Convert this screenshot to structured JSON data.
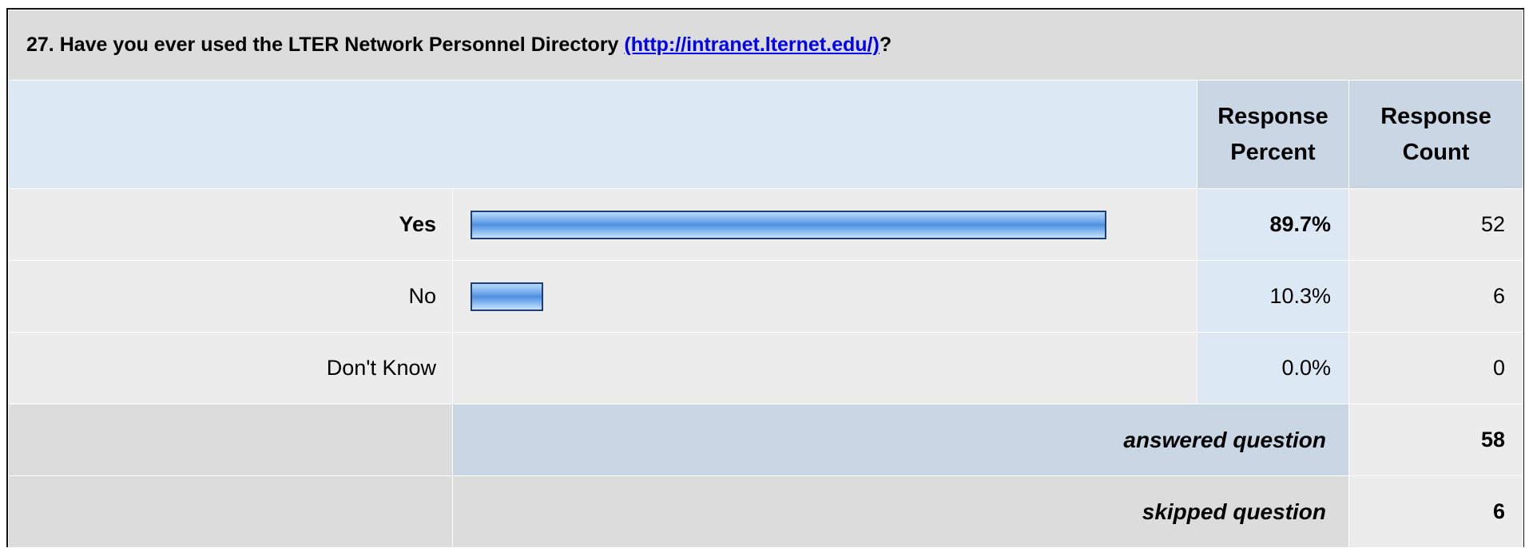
{
  "question": {
    "prefix": "27. Have you ever used the LTER Network Personnel Directory ",
    "link_text": "(http://intranet.lternet.edu/)",
    "suffix": "?"
  },
  "columns": {
    "percent": [
      "Response",
      "Percent"
    ],
    "count": [
      "Response",
      "Count"
    ]
  },
  "rows": [
    {
      "label": "Yes",
      "percent_text": "89.7%",
      "count_text": "52",
      "bold": true
    },
    {
      "label": "No",
      "percent_text": "10.3%",
      "count_text": "6",
      "bold": false
    },
    {
      "label": "Don't Know",
      "percent_text": "0.0%",
      "count_text": "0",
      "bold": false
    }
  ],
  "footer": {
    "answered_label": "answered question",
    "answered_count": "58",
    "skipped_label": "skipped question",
    "skipped_count": "6"
  },
  "colors": {
    "bar_border": "#1f3f77",
    "bar_fill": "#82b4ef",
    "header_bg": "#c9d7e5",
    "percent_bg": "#dde8f5",
    "row_bg": "#ececec",
    "title_bg": "#dcdcdc",
    "link": "#0000ee"
  },
  "chart_data": {
    "type": "bar",
    "orientation": "horizontal",
    "categories": [
      "Yes",
      "No",
      "Don't Know"
    ],
    "values": [
      89.7,
      10.3,
      0.0
    ],
    "counts": [
      52,
      6,
      0
    ],
    "xlim": [
      0,
      100
    ],
    "title": "27. Have you ever used the LTER Network Personnel Directory (http://intranet.lternet.edu/)?"
  }
}
